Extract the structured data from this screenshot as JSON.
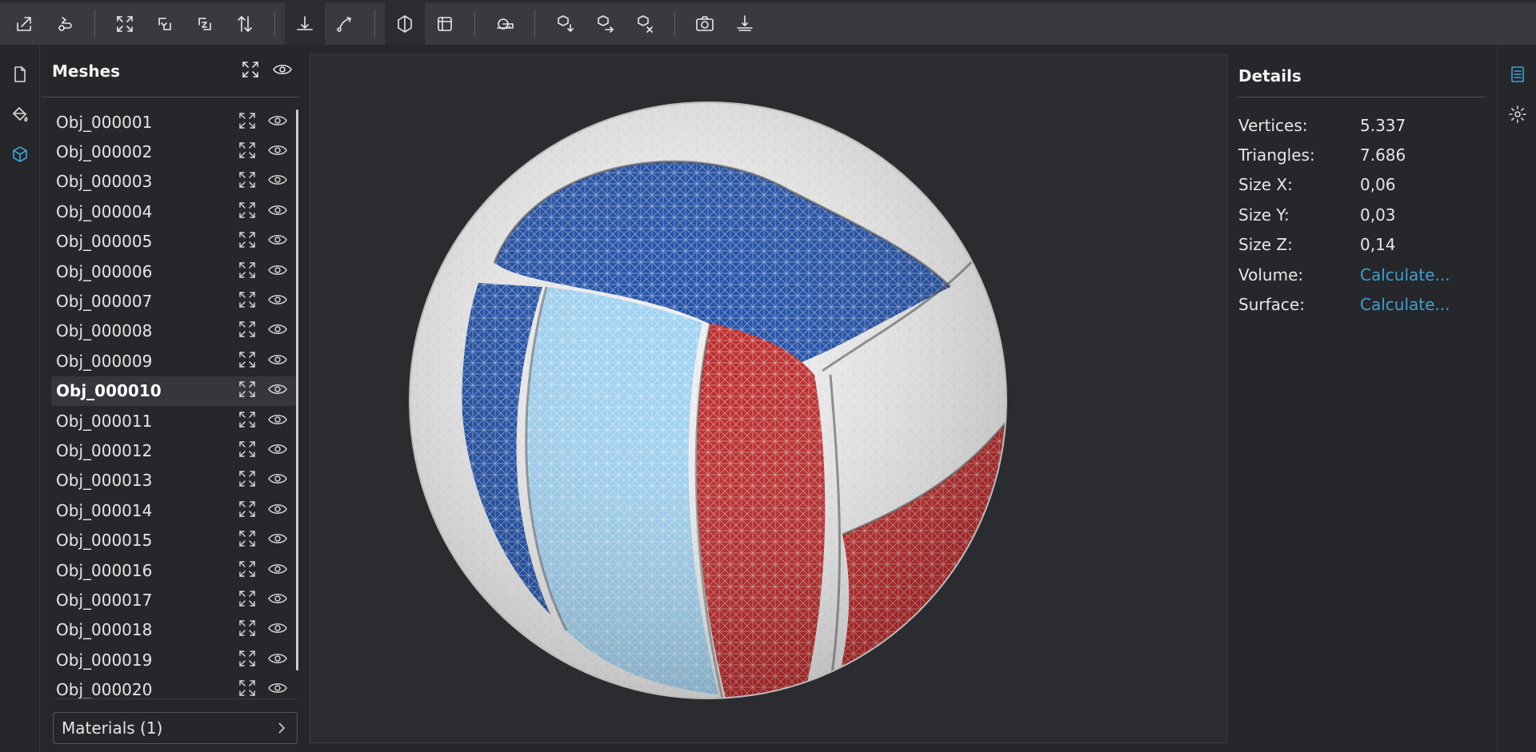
{
  "toolbar": {
    "buttons": [
      {
        "icon": "import-icon"
      },
      {
        "icon": "export-icon"
      },
      {
        "icon": "fit-all-icon"
      },
      {
        "icon": "rotate-y-icon"
      },
      {
        "icon": "rotate-z-icon"
      },
      {
        "icon": "flip-icon"
      },
      {
        "icon": "align-bottom-icon",
        "active": true
      },
      {
        "icon": "path-icon"
      },
      {
        "icon": "solid-view-icon",
        "active": true
      },
      {
        "icon": "box-view-icon"
      },
      {
        "icon": "measure-icon"
      },
      {
        "icon": "move-down-icon"
      },
      {
        "icon": "move-right-icon"
      },
      {
        "icon": "move-code-icon"
      },
      {
        "icon": "camera-icon"
      },
      {
        "icon": "ground-icon"
      }
    ]
  },
  "left_rail": [
    "file-icon",
    "paint-bucket-icon",
    "cube-icon"
  ],
  "meshes": {
    "title": "Meshes",
    "items": [
      "Obj_000001",
      "Obj_000002",
      "Obj_000003",
      "Obj_000004",
      "Obj_000005",
      "Obj_000006",
      "Obj_000007",
      "Obj_000008",
      "Obj_000009",
      "Obj_000010",
      "Obj_000011",
      "Obj_000012",
      "Obj_000013",
      "Obj_000014",
      "Obj_000015",
      "Obj_000016",
      "Obj_000017",
      "Obj_000018",
      "Obj_000019",
      "Obj_000020"
    ],
    "selected_index": 9
  },
  "materials": {
    "label": "Materials (1)"
  },
  "details": {
    "title": "Details",
    "rows": [
      {
        "label": "Vertices:",
        "value": "5.337",
        "link": false
      },
      {
        "label": "Triangles:",
        "value": "7.686",
        "link": false
      },
      {
        "label": "Size X:",
        "value": "0,06",
        "link": false
      },
      {
        "label": "Size Y:",
        "value": "0,03",
        "link": false
      },
      {
        "label": "Size Z:",
        "value": "0,14",
        "link": false
      },
      {
        "label": "Volume:",
        "value": "Calculate...",
        "link": true
      },
      {
        "label": "Surface:",
        "value": "Calculate...",
        "link": true
      }
    ]
  },
  "right_rail": [
    "details-list-icon",
    "gear-icon"
  ],
  "colors": {
    "accent": "#3c9fd0",
    "ball_blue": "#1f4fa8",
    "ball_lightblue": "#9fd2f2",
    "ball_red": "#bd2a2a"
  }
}
